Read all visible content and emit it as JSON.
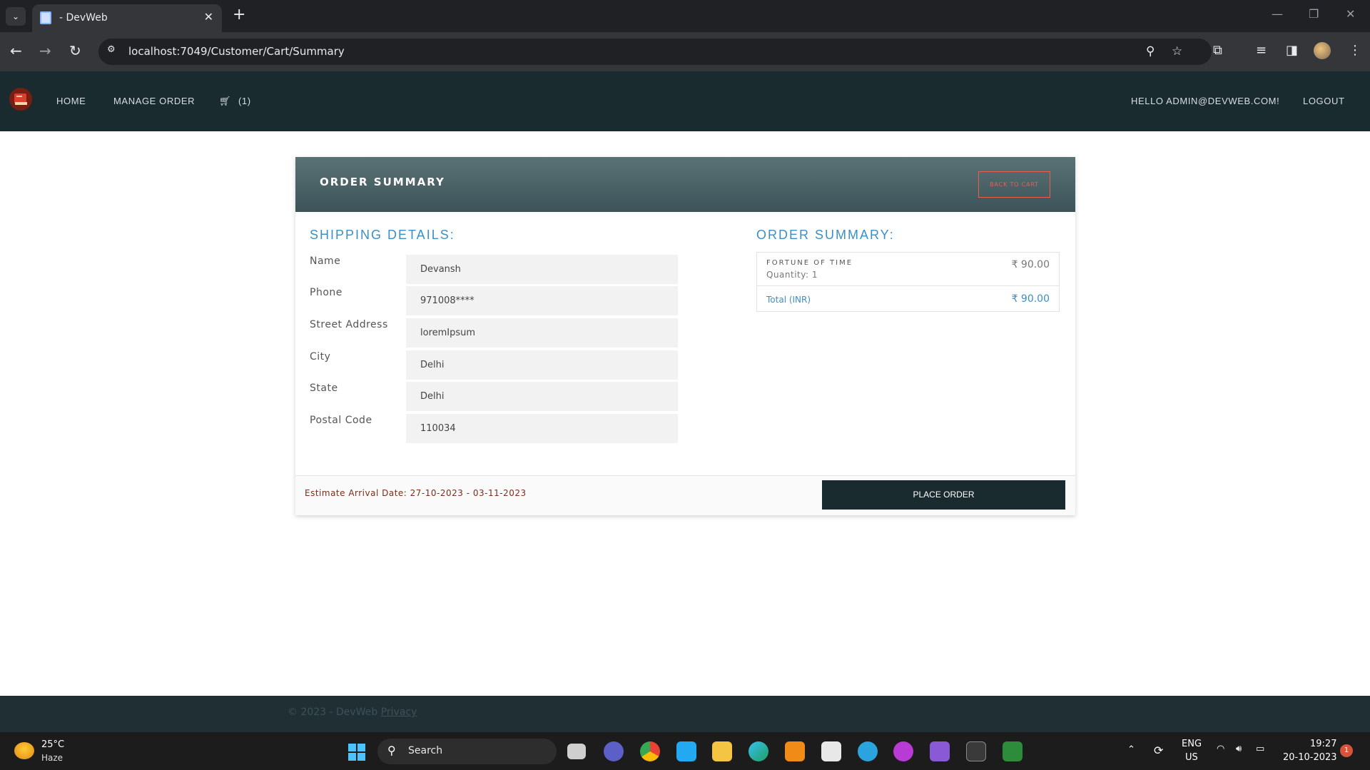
{
  "browser": {
    "tab_title": "- DevWeb",
    "url": "localhost:7049/Customer/Cart/Summary"
  },
  "nav": {
    "home": "HOME",
    "manage_order": "MANAGE ORDER",
    "cart_count": "(1)",
    "greeting": "HELLO ADMIN@DEVWEB.COM!",
    "logout": "LOGOUT"
  },
  "card": {
    "title": "ORDER SUMMARY",
    "back_button": "BACK TO CART",
    "shipping_heading": "SHIPPING DETAILS:",
    "summary_heading": "ORDER SUMMARY:",
    "fields": {
      "name_label": "Name",
      "name_value": "Devansh",
      "phone_label": "Phone",
      "phone_value": "971008****",
      "street_label": "Street Address",
      "street_value": "loremIpsum",
      "city_label": "City",
      "city_value": "Delhi",
      "state_label": "State",
      "state_value": "Delhi",
      "postal_label": "Postal Code",
      "postal_value": "110034"
    },
    "item": {
      "name": "FORTUNE OF TIME",
      "quantity": "Quantity: 1",
      "price": "₹ 90.00"
    },
    "total": {
      "label": "Total (INR)",
      "value": "₹ 90.00"
    },
    "arrival": "Estimate Arrival Date: 27-10-2023 - 03-11-2023",
    "place_order": "PLACE ORDER"
  },
  "footer": {
    "copyright": "© 2023 - DevWeb",
    "privacy": "Privacy"
  },
  "taskbar": {
    "temperature": "25°C",
    "weather": "Haze",
    "search": "Search",
    "lang_1": "ENG",
    "lang_2": "US",
    "time": "19:27",
    "date": "20-10-2023",
    "notification_count": "1"
  },
  "colors": {
    "navbar": "#1a2b30",
    "accent_blue": "#3a8fc7",
    "back_button": "#e8604c",
    "arrival_text": "#7a2e1a"
  }
}
